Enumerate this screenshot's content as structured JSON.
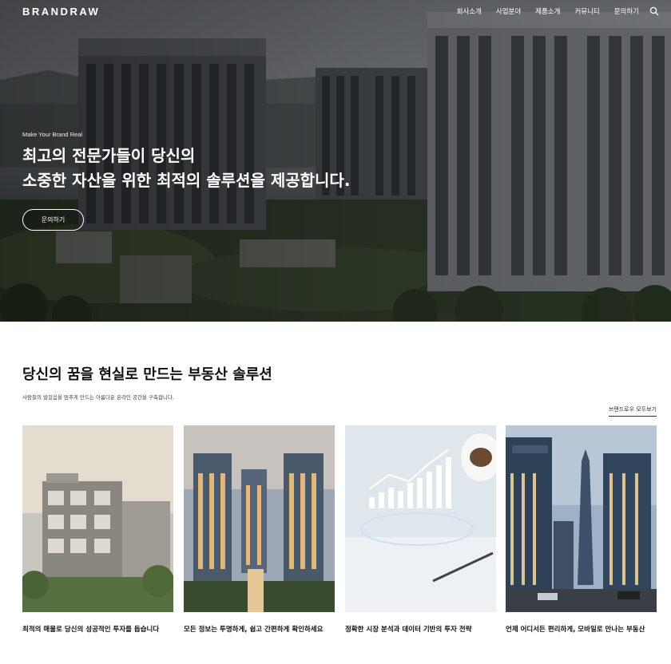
{
  "header": {
    "logo": "BRANDRAW",
    "menu": [
      "회사소개",
      "사업분야",
      "제품소개",
      "커뮤니티",
      "문의하기"
    ]
  },
  "hero": {
    "tagline": "Make Your Brand Real",
    "title_line1": "최고의 전문가들이 당신의",
    "title_line2": "소중한 자산을 위한 최적의 솔루션을 제공합니다.",
    "cta": "문의하기"
  },
  "section": {
    "title": "당신의 꿈을 현실로 만드는 부동산 솔루션",
    "description": "사람들의 발걸음을 멈추게 만드는 아름다운 온라인 공간을 구축합니다.",
    "view_all": "브랜드로우 모두보기"
  },
  "cards": [
    {
      "title": "최적의 매물로 당신의 성공적인 투자를 돕습니다"
    },
    {
      "title": "모든 정보는 투명하게, 쉽고 간편하게 확인하세요"
    },
    {
      "title": "정확한 시장 분석과 데이터 기반의 투자 전략"
    },
    {
      "title": "언제 어디서든 편리하게, 모바일로 만나는 부동산"
    }
  ],
  "colors": {
    "text": "#111111",
    "hero_overlay": "#000000",
    "white": "#ffffff"
  }
}
